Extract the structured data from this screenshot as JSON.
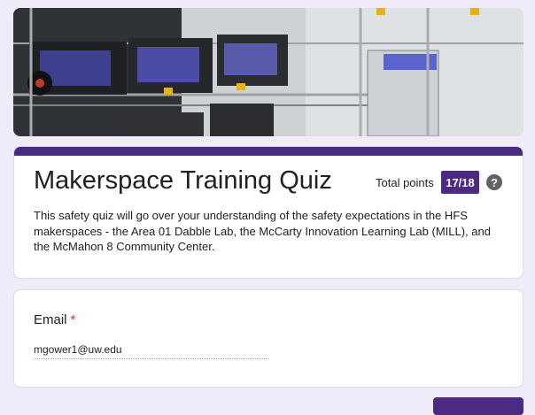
{
  "header": {
    "title": "Makerspace Training Quiz",
    "points_label": "Total points",
    "points_value": "17/18",
    "help_icon": "help-circle-icon",
    "description": "This safety quiz will go over your understanding of the safety expectations in the HFS makerspaces - the Area 01 Dabble Lab, the McCarty Innovation Learning Lab (MILL), and the McMahon 8 Community Center."
  },
  "email": {
    "label": "Email",
    "required_mark": "*",
    "value": "mgower1@uw.edu"
  },
  "colors": {
    "accent": "#4b2a83",
    "background": "#f0ebf8",
    "required": "#d93025"
  }
}
